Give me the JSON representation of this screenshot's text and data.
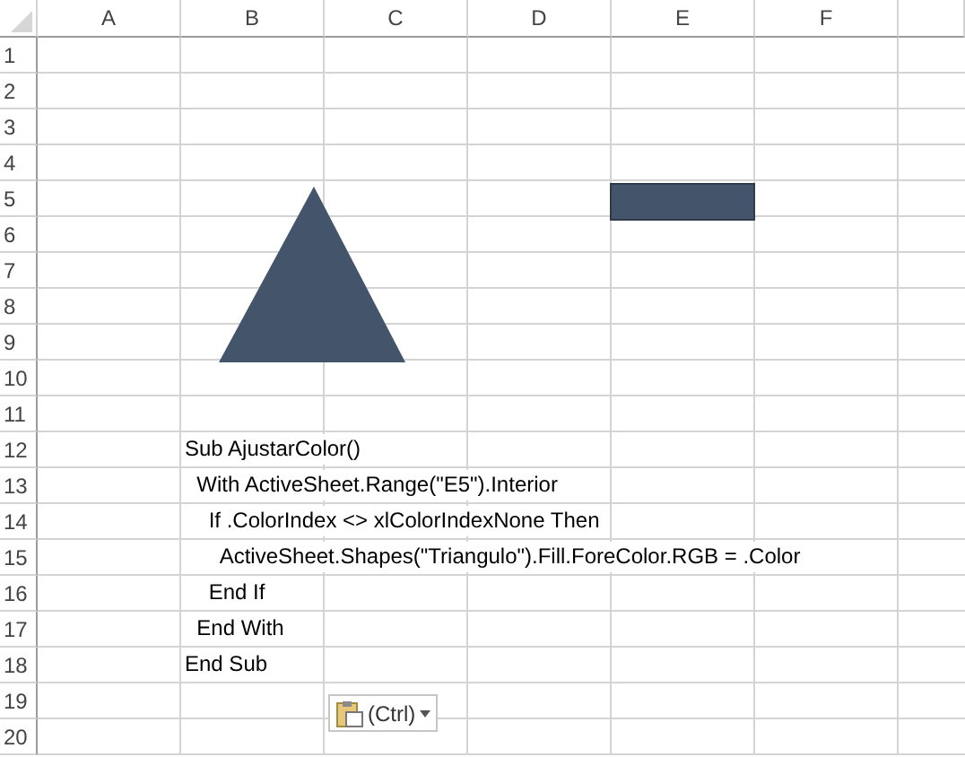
{
  "columns": [
    "A",
    "B",
    "C",
    "D",
    "E",
    "F"
  ],
  "rows": [
    {
      "number": "1"
    },
    {
      "number": "2"
    },
    {
      "number": "3"
    },
    {
      "number": "4"
    },
    {
      "number": "5"
    },
    {
      "number": "6"
    },
    {
      "number": "7"
    },
    {
      "number": "8"
    },
    {
      "number": "9"
    },
    {
      "number": "10"
    },
    {
      "number": "11"
    },
    {
      "number": "12",
      "text": "Sub AjustarColor()"
    },
    {
      "number": "13",
      "text": "  With ActiveSheet.Range(\"E5\").Interior"
    },
    {
      "number": "14",
      "text": "    If .ColorIndex <> xlColorIndexNone Then"
    },
    {
      "number": "15",
      "text": "      ActiveSheet.Shapes(\"Triangulo\").Fill.ForeColor.RGB = .Color"
    },
    {
      "number": "16",
      "text": "    End If"
    },
    {
      "number": "17",
      "text": "  End With"
    },
    {
      "number": "18",
      "text": "End Sub"
    },
    {
      "number": "19"
    },
    {
      "number": "20"
    }
  ],
  "paste_options": {
    "label": "(Ctrl)"
  }
}
